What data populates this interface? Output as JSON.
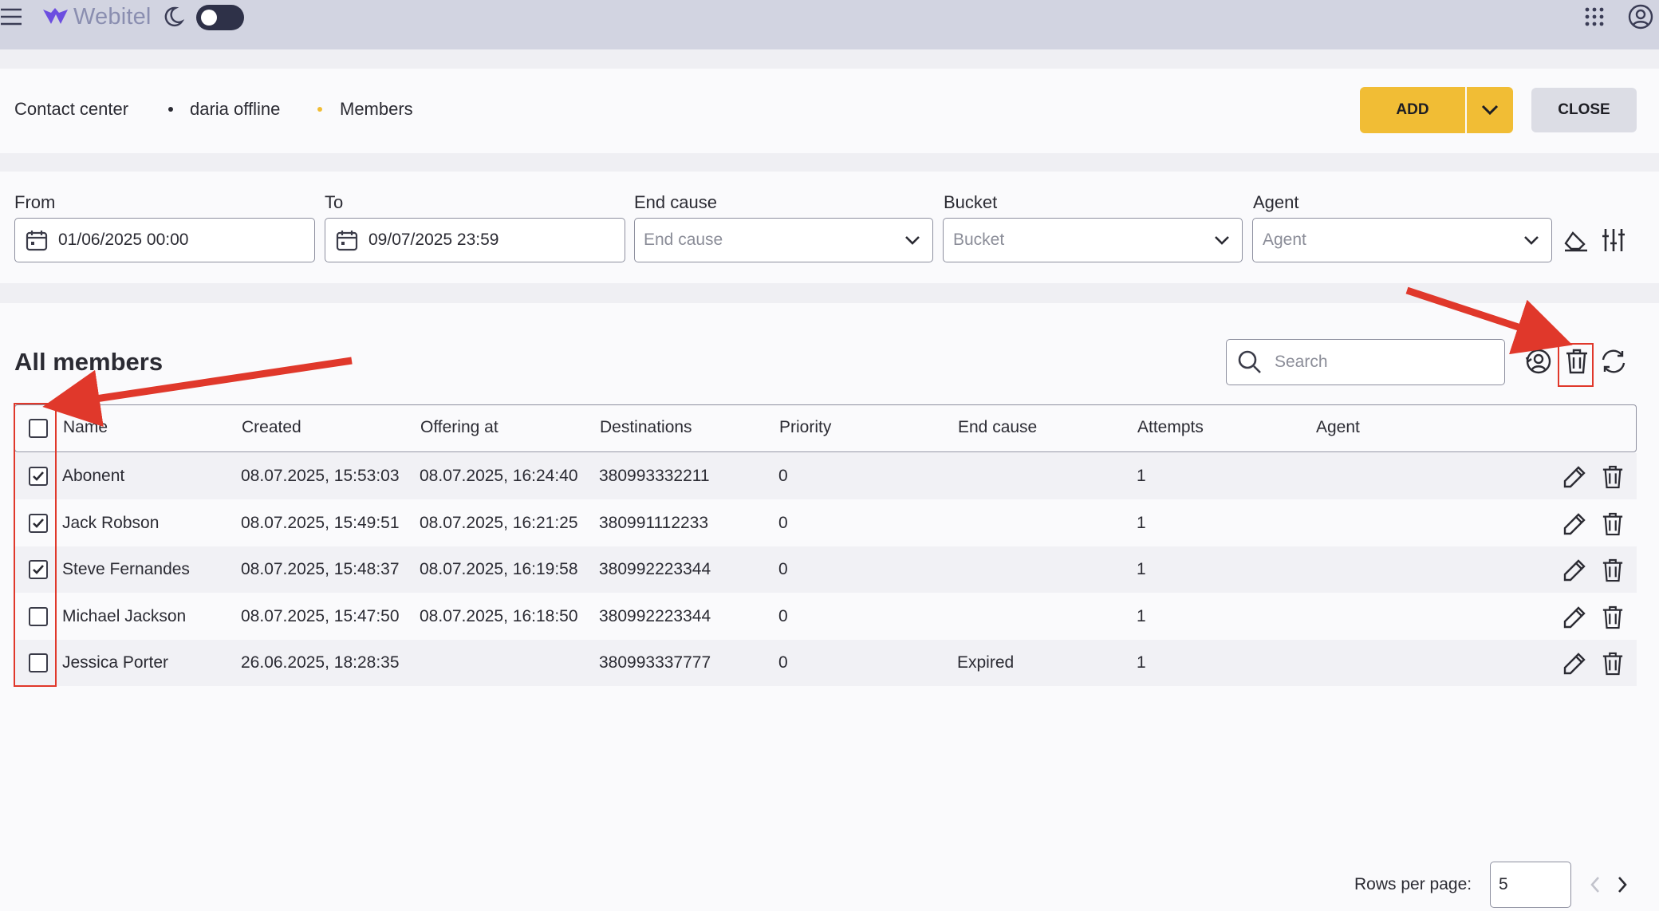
{
  "app": {
    "brand": "Webitel"
  },
  "breadcrumb": [
    {
      "label": "Contact center",
      "dot_color": ""
    },
    {
      "label": "daria offline",
      "dot_color": "#2b2b33"
    },
    {
      "label": "Members",
      "dot_color": "#f1bd35"
    }
  ],
  "actions": {
    "add_label": "ADD",
    "close_label": "CLOSE"
  },
  "filters": {
    "from": {
      "label": "From",
      "value": "01/06/2025 00:00"
    },
    "to": {
      "label": "To",
      "value": "09/07/2025 23:59"
    },
    "end_cause": {
      "label": "End cause",
      "placeholder": "End cause"
    },
    "bucket": {
      "label": "Bucket",
      "placeholder": "Bucket"
    },
    "agent": {
      "label": "Agent",
      "placeholder": "Agent"
    }
  },
  "list": {
    "title": "All members",
    "search_placeholder": "Search",
    "columns": [
      "Name",
      "Created",
      "Offering at",
      "Destinations",
      "Priority",
      "End cause",
      "Attempts",
      "Agent"
    ],
    "rows": [
      {
        "checked": true,
        "name": "Abonent",
        "created": "08.07.2025, 15:53:03",
        "offering_at": "08.07.2025, 16:24:40",
        "destinations": "380993332211",
        "priority": "0",
        "end_cause": "",
        "attempts": "1",
        "agent": ""
      },
      {
        "checked": true,
        "name": "Jack Robson",
        "created": "08.07.2025, 15:49:51",
        "offering_at": "08.07.2025, 16:21:25",
        "destinations": "380991112233",
        "priority": "0",
        "end_cause": "",
        "attempts": "1",
        "agent": ""
      },
      {
        "checked": true,
        "name": "Steve Fernandes",
        "created": "08.07.2025, 15:48:37",
        "offering_at": "08.07.2025, 16:19:58",
        "destinations": "380992223344",
        "priority": "0",
        "end_cause": "",
        "attempts": "1",
        "agent": ""
      },
      {
        "checked": false,
        "name": "Michael Jackson",
        "created": "08.07.2025, 15:47:50",
        "offering_at": "08.07.2025, 16:18:50",
        "destinations": "380992223344",
        "priority": "0",
        "end_cause": "",
        "attempts": "1",
        "agent": ""
      },
      {
        "checked": false,
        "name": "Jessica Porter",
        "created": "26.06.2025, 18:28:35",
        "offering_at": "",
        "destinations": "380993337777",
        "priority": "0",
        "end_cause": "Expired",
        "attempts": "1",
        "agent": ""
      }
    ]
  },
  "pagination": {
    "rows_per_page_label": "Rows per page:",
    "rows_per_page": "5"
  },
  "icons": {
    "menu": "menu-icon",
    "theme": "moon-icon",
    "apps": "apps-grid-icon",
    "account": "account-icon",
    "calendar": "calendar-icon",
    "clear": "eraser-icon",
    "settings": "sliders-icon",
    "search": "search-icon",
    "reset": "user-reset-icon",
    "delete": "trash-icon",
    "refresh": "refresh-icon",
    "edit": "pencil-icon",
    "prev": "chevron-left-icon",
    "next": "chevron-right-icon"
  },
  "colors": {
    "accent": "#f1bd35",
    "annotation": "#e0382b",
    "topbar": "#d2d4e1"
  }
}
